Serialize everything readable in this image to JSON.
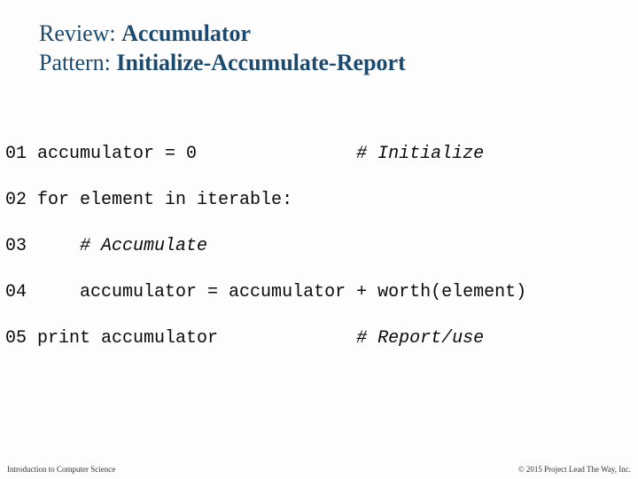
{
  "title": {
    "line1_light": "Review: ",
    "line1_bold": "Accumulator",
    "line2_light": "Pattern: ",
    "line2_bold": "Initialize-Accumulate-Report"
  },
  "code": {
    "l1_num": "01",
    "l1_a": " accumulator = 0               ",
    "l1_c": "# Initialize",
    "l2_num": "02",
    "l2_a": " for element in iterable:",
    "l3_num": "03",
    "l3_a": "     ",
    "l3_c": "# Accumulate",
    "l4_num": "04",
    "l4_a": "     accumulator = accumulator + worth(element)",
    "l5_num": "05",
    "l5_a": " print accumulator             ",
    "l5_c": "# Report/use"
  },
  "footer": {
    "left": "Introduction to Computer Science",
    "right": "© 2015 Project Lead The Way, Inc."
  }
}
